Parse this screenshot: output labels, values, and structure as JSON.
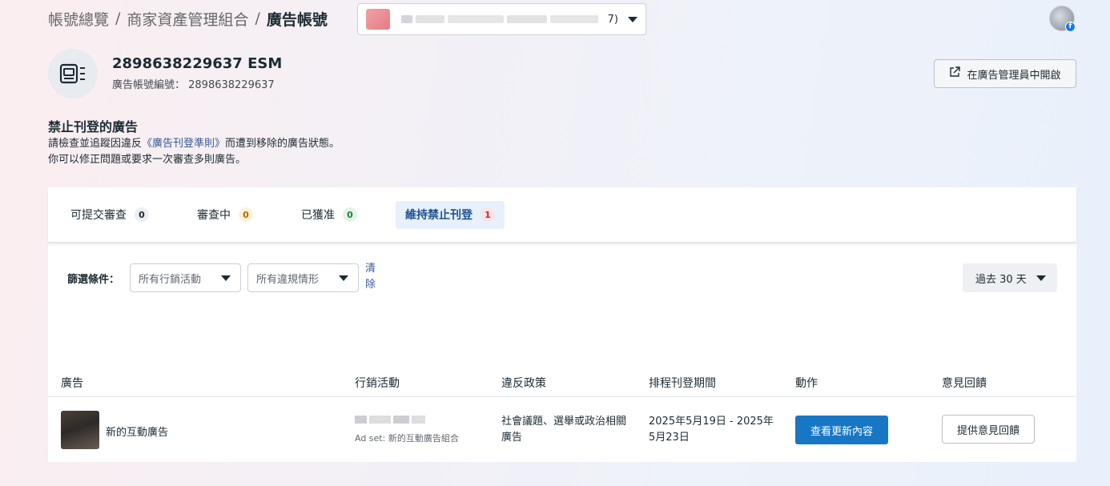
{
  "breadcrumb": {
    "items": [
      "帳號總覽",
      "商家資產管理組合"
    ],
    "separator": "/",
    "current": "廣告帳號"
  },
  "account_selector": {
    "suffix": "7)",
    "icon": "chevron-down-icon"
  },
  "account": {
    "name": "2898638229637 ESM",
    "id_line": "廣告帳號編號： 2898638229637",
    "icon": "ad-account-icon"
  },
  "open_in_ads_manager": {
    "label": "在廣告管理員中開啟",
    "icon": "external-link-icon"
  },
  "section": {
    "title": "禁止刊登的廣告",
    "desc_prefix": "請檢查並追蹤因違反",
    "desc_link": "《廣告刊登準則》",
    "desc_suffix": "而遭到移除的廣告狀態。",
    "desc_line2": "你可以修正問題或要求一次審查多則廣告。"
  },
  "tabs": [
    {
      "label": "可提交審查",
      "count": "0"
    },
    {
      "label": "審查中",
      "count": "0"
    },
    {
      "label": "已獲准",
      "count": "0"
    },
    {
      "label": "維持禁止刊登",
      "count": "1"
    }
  ],
  "filters": {
    "label": "篩選條件：",
    "campaign": "所有行銷活動",
    "violation": "所有違規情形",
    "clear": "清除",
    "date_range": "過去 30 天"
  },
  "table": {
    "headers": [
      "廣告",
      "行銷活動",
      "違反政策",
      "排程刊登期間",
      "動作",
      "意見回饋"
    ],
    "rows": [
      {
        "ad_name": "新的互動廣告",
        "adset": "Ad set: 新的互動廣告組合",
        "policy": "社會議題、選舉或政治相關廣告",
        "schedule": "2025年5月19日 - 2025年5月23日",
        "action": "查看更新內容",
        "feedback": "提供意見回饋"
      }
    ]
  },
  "colors": {
    "primary": "#1877c5",
    "link": "#385898",
    "tab_active_bg": "#e7f0fb",
    "badge_red": "#c0282d"
  }
}
